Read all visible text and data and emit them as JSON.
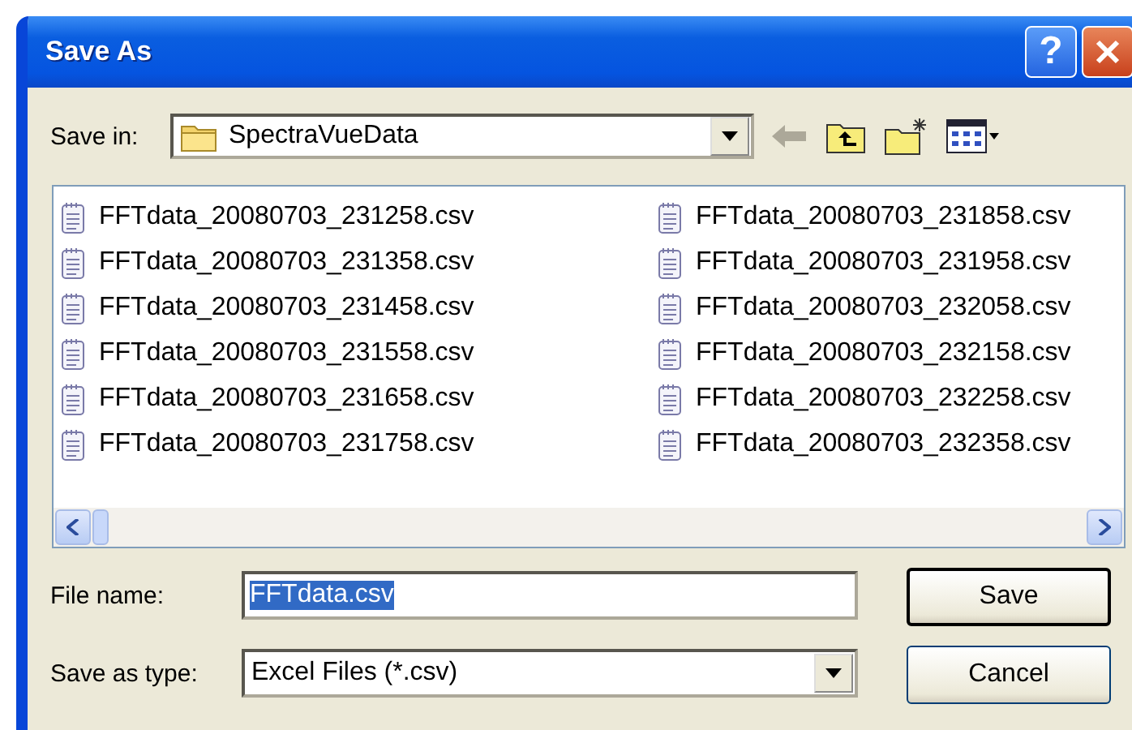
{
  "window": {
    "title": "Save As",
    "help_label": "?"
  },
  "save_in": {
    "label": "Save in:",
    "value": "SpectraVueData"
  },
  "toolbar": {
    "back_disabled": true
  },
  "files": [
    "FFTdata_20080703_231258.csv",
    "FFTdata_20080703_231358.csv",
    "FFTdata_20080703_231458.csv",
    "FFTdata_20080703_231558.csv",
    "FFTdata_20080703_231658.csv",
    "FFTdata_20080703_231758.csv",
    "FFTdata_20080703_231858.csv",
    "FFTdata_20080703_231958.csv",
    "FFTdata_20080703_232058.csv",
    "FFTdata_20080703_232158.csv",
    "FFTdata_20080703_232258.csv",
    "FFTdata_20080703_232358.csv"
  ],
  "file_name": {
    "label": "File name:",
    "value": "FFTdata.csv",
    "highlighted": true
  },
  "save_as_type": {
    "label": "Save as type:",
    "value": "Excel Files (*.csv)"
  },
  "buttons": [
    {
      "label": "Save",
      "default": true
    },
    {
      "label": "Cancel",
      "default": false
    }
  ]
}
